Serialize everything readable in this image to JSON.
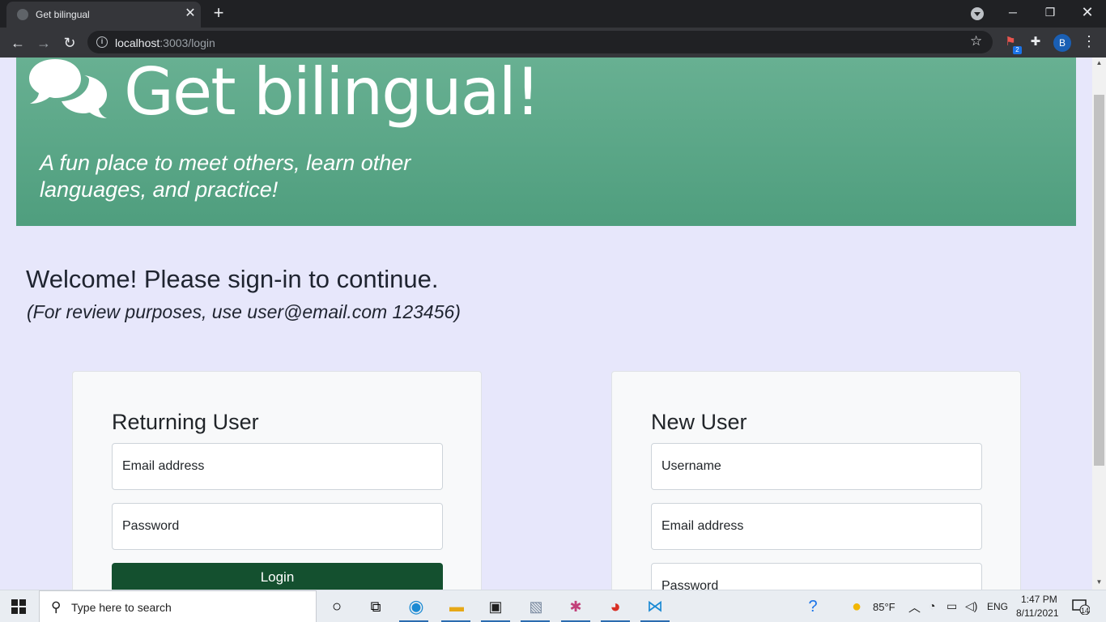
{
  "browser": {
    "tab_title": "Get bilingual",
    "url_host": "localhost",
    "url_rest": ":3003/login",
    "profile_initial": "B",
    "extension_badge": "2"
  },
  "hero": {
    "title": "Get bilingual!",
    "tagline": "A fun place to meet others, learn other languages, and practice!"
  },
  "intro": {
    "welcome": "Welcome! Please sign-in to continue.",
    "review_note": "(For review purposes, use user@email.com 123456)"
  },
  "login_card": {
    "title": "Returning User",
    "email_placeholder": "Email address",
    "password_placeholder": "Password",
    "submit_label": "Login"
  },
  "signup_card": {
    "title": "New User",
    "username_placeholder": "Username",
    "email_placeholder": "Email address",
    "password_placeholder": "Password"
  },
  "taskbar": {
    "search_placeholder": "Type here to search",
    "temperature": "85°F",
    "language": "ENG",
    "time": "1:47 PM",
    "date": "8/11/2021",
    "notification_count": "14"
  },
  "colors": {
    "hero_top": "#69b193",
    "hero_bottom": "#4f9e7e",
    "page_background": "#e7e7fb",
    "login_button": "#14502f"
  }
}
